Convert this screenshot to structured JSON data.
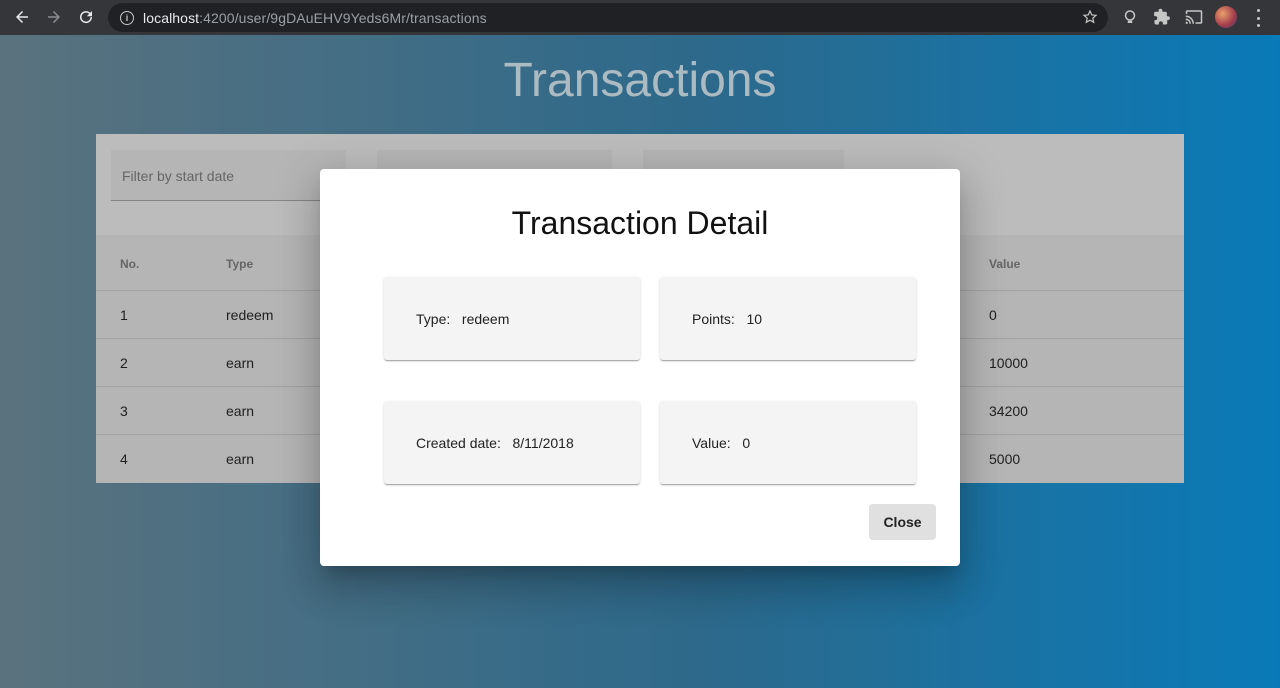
{
  "browser": {
    "url_host": "localhost",
    "url_path": ":4200/user/9gDAuEHV9Yeds6Mr/transactions",
    "icons": [
      "back-icon",
      "forward-icon",
      "reload-icon",
      "info-icon",
      "star-icon",
      "lens-icon",
      "extensions-icon",
      "cast-icon",
      "profile-avatar",
      "menu-icon"
    ]
  },
  "page": {
    "title": "Transactions",
    "filters": {
      "start_date_placeholder": "Filter by start date"
    },
    "table": {
      "columns": [
        "No.",
        "Type",
        "Value"
      ],
      "rows": [
        {
          "no": "1",
          "type": "redeem",
          "value": "0"
        },
        {
          "no": "2",
          "type": "earn",
          "value": "10000"
        },
        {
          "no": "3",
          "type": "earn",
          "value": "34200"
        },
        {
          "no": "4",
          "type": "earn",
          "value": "5000"
        }
      ]
    }
  },
  "dialog": {
    "title": "Transaction Detail",
    "fields": [
      {
        "label": "Type:",
        "value": "redeem",
        "text": "Type:   redeem"
      },
      {
        "label": "Points:",
        "value": "10",
        "text": "Points:   10"
      },
      {
        "label": "Created date:",
        "value": "8/11/2018",
        "text": "Created date:   8/11/2018"
      },
      {
        "label": "Value:",
        "value": "0",
        "text": "Value:   0"
      }
    ],
    "close_label": "Close"
  },
  "colors": {
    "chrome": "#35363a",
    "omnibox": "#202124",
    "gradient_start": "#5e7784",
    "gradient_end": "#0a7fc0",
    "detail_card": "#f4f4f4",
    "close_button": "#e0e0e0"
  }
}
